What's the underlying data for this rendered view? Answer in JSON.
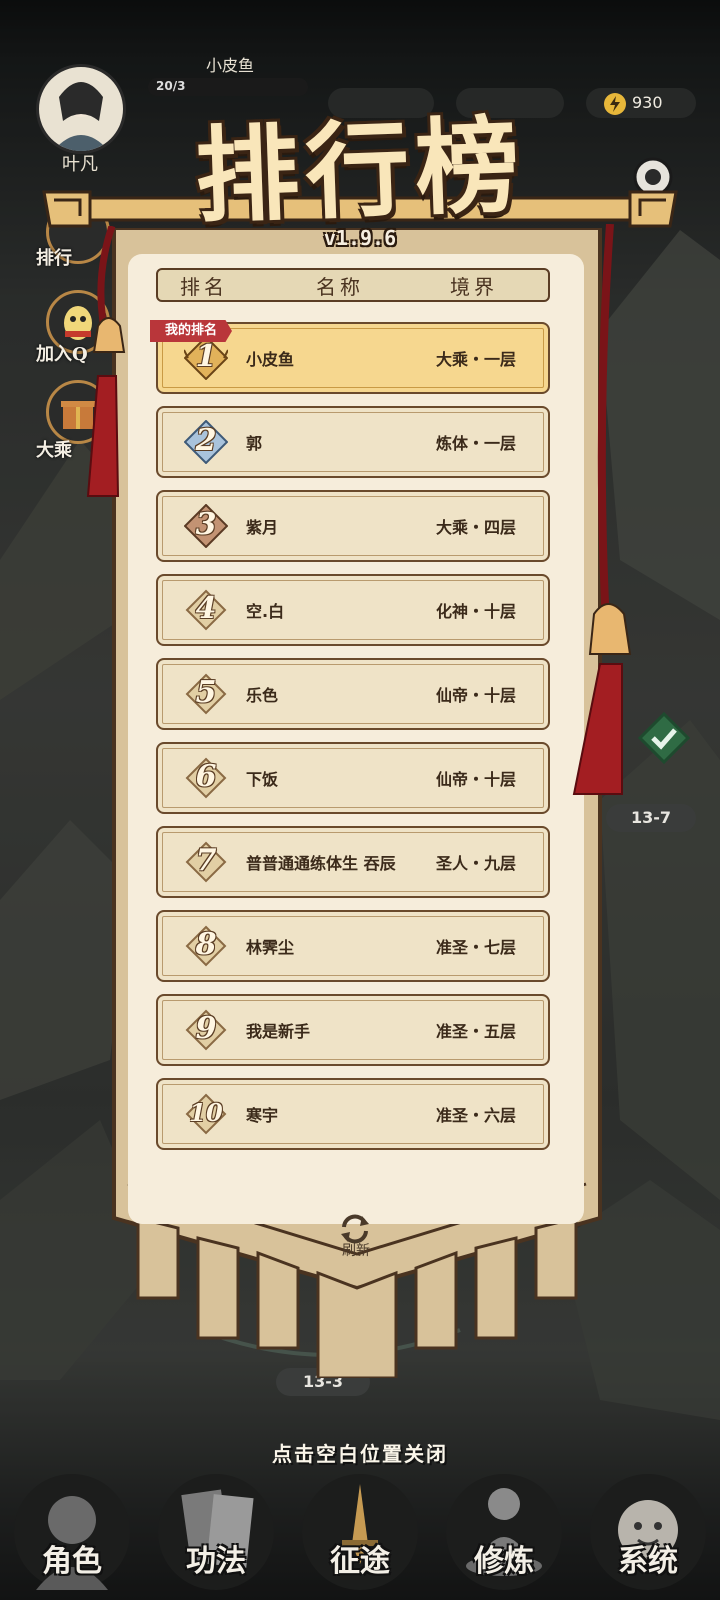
{
  "player": {
    "name": "小皮鱼",
    "exp_text": "20/3",
    "avatar_label": "叶凡"
  },
  "currency": {
    "energy": "930"
  },
  "side_menu": [
    {
      "label": "排行"
    },
    {
      "label": "加入Q"
    },
    {
      "label": "大乘"
    }
  ],
  "leaderboard": {
    "title": "排行榜",
    "version": "v1.9.6",
    "headers": {
      "rank": "排名",
      "name": "名称",
      "realm": "境界"
    },
    "my_rank_tag": "我的排名",
    "rows": [
      {
        "rank": "1",
        "name": "小皮鱼",
        "realm": "大乘・一层"
      },
      {
        "rank": "2",
        "name": "郭",
        "realm": "炼体・一层"
      },
      {
        "rank": "3",
        "name": "紫月",
        "realm": "大乘・四层"
      },
      {
        "rank": "4",
        "name": "空.白",
        "realm": "化神・十层"
      },
      {
        "rank": "5",
        "name": "乐色",
        "realm": "仙帝・十层"
      },
      {
        "rank": "6",
        "name": "下饭",
        "realm": "仙帝・十层"
      },
      {
        "rank": "7",
        "name": "普普通通练体生 吞辰",
        "realm": "圣人・九层"
      },
      {
        "rank": "8",
        "name": "林霁尘",
        "realm": "准圣・七层"
      },
      {
        "rank": "9",
        "name": "我是新手",
        "realm": "准圣・五层"
      },
      {
        "rank": "10",
        "name": "寒宇",
        "realm": "准圣・六层"
      }
    ],
    "refresh_label": "刷新"
  },
  "map": {
    "stage_right": "13-7",
    "stage_bottom": "13-3"
  },
  "close_hint": "点击空白位置关闭",
  "bottom_nav": [
    {
      "label": "角色",
      "icon": "character-icon"
    },
    {
      "label": "功法",
      "icon": "skill-book-icon"
    },
    {
      "label": "征途",
      "icon": "journey-sword-icon"
    },
    {
      "label": "修炼",
      "icon": "meditation-icon"
    },
    {
      "label": "系统",
      "icon": "system-icon"
    }
  ],
  "colors": {
    "panel": "#f6eddb",
    "banner": "#d9c39a",
    "highlight_row": "#f6d78f",
    "my_tag": "#b9363a",
    "tassel": "#a31e22",
    "energy": "#e7b73a"
  }
}
